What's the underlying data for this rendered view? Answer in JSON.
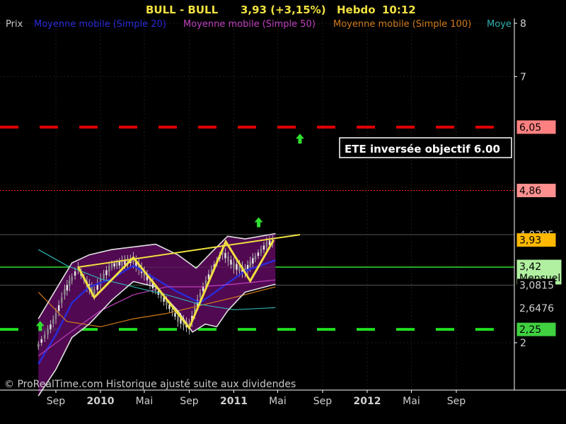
{
  "header": {
    "title": "BULL - BULL",
    "price": "3,93 (+3,15%)",
    "period": "Hebdo",
    "time": "10:12"
  },
  "legend": [
    {
      "label": "Prix",
      "color": "#c8c8c8"
    },
    {
      "label": "Moyenne mobile (Simple 20)",
      "color": "#2a2ad8"
    },
    {
      "label": "Moyenne mobile (Simple 50)",
      "color": "#c040c0"
    },
    {
      "label": "Moyenne mobile (Simple 100)",
      "color": "#d07a1a"
    },
    {
      "label": "Moye",
      "color": "#30b0b0"
    }
  ],
  "annotation": "ETE  inversée objectif 6.00",
  "footer": "© ProRealTime.com Historique ajusté suite aux dividendes",
  "chart_data": {
    "type": "candlestick",
    "y_ticks": [
      {
        "value": 8,
        "label": "8"
      },
      {
        "value": 7,
        "label": "7"
      },
      {
        "value": 2,
        "label": "2"
      }
    ],
    "x_ticks": [
      {
        "date": "2009-09",
        "label": "Sep",
        "bold": false
      },
      {
        "date": "2010-01",
        "label": "2010",
        "bold": true
      },
      {
        "date": "2010-05",
        "label": "Mai",
        "bold": false
      },
      {
        "date": "2010-09",
        "label": "Sep",
        "bold": false
      },
      {
        "date": "2011-01",
        "label": "2011",
        "bold": true
      },
      {
        "date": "2011-05",
        "label": "Mai",
        "bold": false
      },
      {
        "date": "2011-09",
        "label": "Sep",
        "bold": false
      },
      {
        "date": "2012-01",
        "label": "2012",
        "bold": true
      },
      {
        "date": "2012-05",
        "label": "Mai",
        "bold": false
      },
      {
        "date": "2012-09",
        "label": "Sep",
        "bold": false
      }
    ],
    "price_labels": [
      {
        "value": 6.05,
        "label": "6,05",
        "bg": "#ff8080",
        "fg": "#000000"
      },
      {
        "value": 4.86,
        "label": "4,86",
        "bg": "#ff9090",
        "fg": "#000000"
      },
      {
        "value": 4.0305,
        "label": "4,0305",
        "bg": "#000000",
        "fg": "#d0d0d0"
      },
      {
        "value": 3.93,
        "label": "3,93",
        "bg": "#ffb800",
        "fg": "#000000"
      },
      {
        "value": 3.42,
        "label": "3,42",
        "bg": "#b0f0a0",
        "fg": "#000000",
        "sub": "Mensuel"
      },
      {
        "value": 3.0815,
        "label": "3,0815",
        "bg": "#000000",
        "fg": "#d0d0d0"
      },
      {
        "value": 2.6476,
        "label": "2,6476",
        "bg": "#000000",
        "fg": "#d0d0d0"
      },
      {
        "value": 2.25,
        "label": "2,25",
        "bg": "#40d040",
        "fg": "#000000"
      }
    ],
    "horizontal_lines": [
      {
        "value": 6.05,
        "color": "#e00000",
        "style": "dashed-thick"
      },
      {
        "value": 4.86,
        "color": "#ff2020",
        "style": "dotted"
      },
      {
        "value": 4.0305,
        "color": "#555555",
        "style": "solid-thin"
      },
      {
        "value": 3.42,
        "color": "#30e030",
        "style": "solid"
      },
      {
        "value": 3.0815,
        "color": "#555555",
        "style": "solid-thin"
      },
      {
        "value": 2.25,
        "color": "#20e020",
        "style": "dashed-thick"
      }
    ],
    "pattern_lines": [
      {
        "name": "neckline",
        "color": "#f0e040",
        "points": [
          [
            "2009-11-01",
            3.42
          ],
          [
            "2011-07-01",
            4.03
          ]
        ]
      },
      {
        "name": "head-and-shoulders",
        "color": "#f0e040",
        "points": [
          [
            "2009-11-01",
            3.42
          ],
          [
            "2009-12-15",
            2.85
          ],
          [
            "2010-04-01",
            3.6
          ],
          [
            "2010-09-01",
            2.28
          ],
          [
            "2010-12-10",
            3.9
          ],
          [
            "2011-02-15",
            3.16
          ],
          [
            "2011-04-20",
            3.93
          ]
        ]
      }
    ],
    "arrows": [
      {
        "date": "2009-07-20",
        "value": 2.3,
        "color": "#30e030"
      },
      {
        "date": "2011-03-10",
        "value": 4.25,
        "color": "#30e030"
      },
      {
        "date": "2011-07-01",
        "value": 5.82,
        "color": "#30e030"
      }
    ],
    "series": [
      {
        "kind": "price",
        "color": "#c8c8c8",
        "points": [
          [
            "2009-07-15",
            1.95
          ],
          [
            "2009-08-10",
            2.2
          ],
          [
            "2009-09-01",
            2.5
          ],
          [
            "2009-09-25",
            2.95
          ],
          [
            "2009-10-15",
            3.2
          ],
          [
            "2009-11-01",
            3.4
          ],
          [
            "2009-11-25",
            3.1
          ],
          [
            "2009-12-15",
            2.95
          ],
          [
            "2010-01-10",
            3.25
          ],
          [
            "2010-02-01",
            3.45
          ],
          [
            "2010-03-01",
            3.5
          ],
          [
            "2010-04-01",
            3.55
          ],
          [
            "2010-05-01",
            3.3
          ],
          [
            "2010-06-01",
            3.0
          ],
          [
            "2010-07-01",
            2.75
          ],
          [
            "2010-08-01",
            2.45
          ],
          [
            "2010-09-01",
            2.3
          ],
          [
            "2010-10-01",
            2.9
          ],
          [
            "2010-11-01",
            3.35
          ],
          [
            "2010-12-01",
            3.7
          ],
          [
            "2011-01-01",
            3.45
          ],
          [
            "2011-02-01",
            3.35
          ],
          [
            "2011-03-01",
            3.6
          ],
          [
            "2011-04-01",
            3.85
          ],
          [
            "2011-04-25",
            3.93
          ]
        ]
      },
      {
        "kind": "ma20",
        "color": "#2a2ad8",
        "points": [
          [
            "2009-07-15",
            1.6
          ],
          [
            "2009-09-01",
            2.15
          ],
          [
            "2009-10-15",
            2.75
          ],
          [
            "2009-12-01",
            3.05
          ],
          [
            "2010-02-01",
            3.2
          ],
          [
            "2010-04-01",
            3.45
          ],
          [
            "2010-06-01",
            3.2
          ],
          [
            "2010-08-01",
            2.95
          ],
          [
            "2010-10-01",
            2.75
          ],
          [
            "2010-12-01",
            3.05
          ],
          [
            "2011-02-01",
            3.35
          ],
          [
            "2011-04-25",
            3.55
          ]
        ]
      },
      {
        "kind": "ma50",
        "color": "#c040c0",
        "points": [
          [
            "2009-07-15",
            1.75
          ],
          [
            "2009-10-01",
            2.15
          ],
          [
            "2010-01-01",
            2.6
          ],
          [
            "2010-04-01",
            2.9
          ],
          [
            "2010-07-01",
            3.05
          ],
          [
            "2010-10-01",
            3.05
          ],
          [
            "2011-01-01",
            3.1
          ],
          [
            "2011-04-25",
            3.18
          ]
        ]
      },
      {
        "kind": "ma100",
        "color": "#d07a1a",
        "points": [
          [
            "2009-07-15",
            2.95
          ],
          [
            "2009-10-01",
            2.4
          ],
          [
            "2010-01-01",
            2.3
          ],
          [
            "2010-04-01",
            2.45
          ],
          [
            "2010-07-01",
            2.55
          ],
          [
            "2010-10-01",
            2.7
          ],
          [
            "2011-01-01",
            2.85
          ],
          [
            "2011-04-25",
            3.05
          ]
        ]
      },
      {
        "kind": "ma200",
        "color": "#30b0b0",
        "points": [
          [
            "2009-07-15",
            3.75
          ],
          [
            "2009-10-01",
            3.45
          ],
          [
            "2010-01-01",
            3.2
          ],
          [
            "2010-04-01",
            3.05
          ],
          [
            "2010-07-01",
            2.9
          ],
          [
            "2010-10-01",
            2.72
          ],
          [
            "2011-01-01",
            2.62
          ],
          [
            "2011-04-25",
            2.66
          ]
        ]
      },
      {
        "kind": "bollinger-upper",
        "color": "#e0e0e0",
        "points": [
          [
            "2009-07-15",
            2.45
          ],
          [
            "2009-09-01",
            3.0
          ],
          [
            "2009-10-15",
            3.5
          ],
          [
            "2009-12-01",
            3.65
          ],
          [
            "2010-02-01",
            3.75
          ],
          [
            "2010-04-01",
            3.8
          ],
          [
            "2010-06-01",
            3.85
          ],
          [
            "2010-08-01",
            3.65
          ],
          [
            "2010-09-20",
            3.4
          ],
          [
            "2010-11-01",
            3.7
          ],
          [
            "2010-12-15",
            4.0
          ],
          [
            "2011-02-01",
            3.95
          ],
          [
            "2011-04-25",
            4.05
          ]
        ]
      },
      {
        "kind": "bollinger-lower",
        "color": "#e0e0e0",
        "points": [
          [
            "2009-07-15",
            1.0
          ],
          [
            "2009-09-01",
            1.5
          ],
          [
            "2009-10-15",
            2.1
          ],
          [
            "2009-12-01",
            2.35
          ],
          [
            "2010-02-01",
            2.8
          ],
          [
            "2010-04-01",
            3.15
          ],
          [
            "2010-06-01",
            3.05
          ],
          [
            "2010-08-01",
            2.6
          ],
          [
            "2010-09-10",
            2.2
          ],
          [
            "2010-10-15",
            2.35
          ],
          [
            "2010-11-15",
            2.3
          ],
          [
            "2010-12-15",
            2.6
          ],
          [
            "2011-02-01",
            2.95
          ],
          [
            "2011-04-25",
            3.1
          ]
        ]
      }
    ]
  }
}
